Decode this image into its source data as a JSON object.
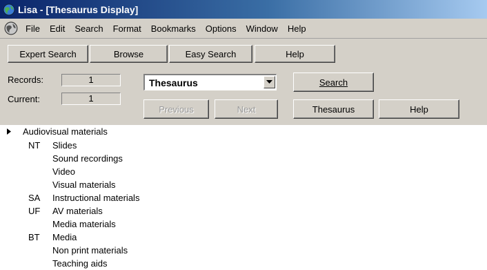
{
  "window": {
    "title": "Lisa - [Thesaurus Display]"
  },
  "menu": {
    "items": [
      "File",
      "Edit",
      "Search",
      "Format",
      "Bookmarks",
      "Options",
      "Window",
      "Help"
    ]
  },
  "toolbar": {
    "expert_search": "Expert Search",
    "browse": "Browse",
    "easy_search": "Easy Search",
    "help": "Help"
  },
  "status": {
    "records_label": "Records:",
    "records_value": "1",
    "current_label": "Current:",
    "current_value": "1"
  },
  "search": {
    "database": "Thesaurus",
    "search_button": "Search",
    "previous": "Previous",
    "next": "Next",
    "thesaurus_button": "Thesaurus",
    "help_button": "Help"
  },
  "thesaurus": {
    "term": "Audiovisual materials",
    "nt_code": "NT",
    "narrower": [
      "Slides",
      "Sound recordings",
      "Video",
      "Visual materials"
    ],
    "sa_code": "SA",
    "see_also": [
      "Instructional materials"
    ],
    "uf_code": "UF",
    "used_for": [
      "AV materials",
      "Media materials"
    ],
    "bt_code": "BT",
    "broader": [
      "Media",
      "Non print materials",
      "Teaching aids"
    ]
  },
  "icons": [
    "globe-icon",
    "dropdown-arrow-icon",
    "expand-triangle-icon"
  ]
}
